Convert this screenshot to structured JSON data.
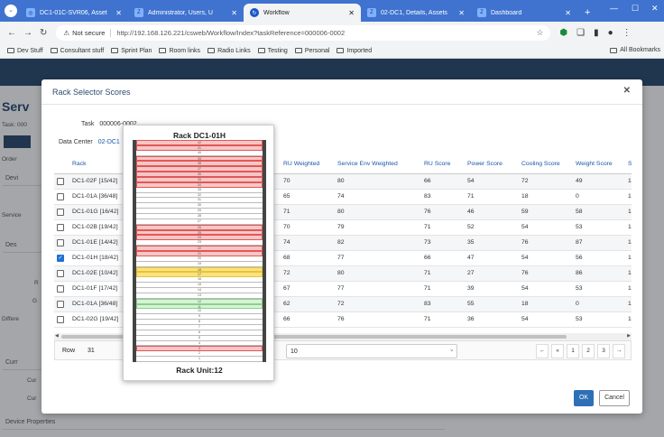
{
  "browser": {
    "tabs": [
      {
        "label": "DC1-01C-SVR06, Asset",
        "active": false
      },
      {
        "label": "Administrator, Users, U",
        "active": false
      },
      {
        "label": "Workflow",
        "active": true
      },
      {
        "label": "02-DC1, Details, Assets",
        "active": false
      },
      {
        "label": "Dashboard",
        "active": false
      }
    ],
    "security_label": "Not secure",
    "url": "http://192.168.126.221/csweb/Workflow/Index?taskReference=000006-0002",
    "bookmarks": [
      "Dev Stuff",
      "Consultant stuff",
      "Sprint Plan",
      "Room links",
      "Radio Links",
      "Testing",
      "Personal",
      "Imported"
    ],
    "all_bookmarks_label": "All Bookmarks"
  },
  "app": {
    "title": "Serv",
    "side_labels": [
      "Task: 000",
      "Order",
      "Service",
      "Differe",
      "R",
      "G",
      "Cur",
      "Cur"
    ],
    "section_labels": [
      "Devi",
      "Des",
      "Curr",
      "Device Properties"
    ]
  },
  "modal": {
    "title": "Rack Selector Scores",
    "task_label": "Task",
    "task_value": "000006-0002",
    "datacenter_label": "Data Center",
    "datacenter_value": "02-DC1",
    "columns": [
      "Rack",
      "RU Weighted",
      "Service Env Weighted",
      "RU Score",
      "Power Score",
      "Cooling Score",
      "Weight Score",
      "Sc"
    ],
    "rows": [
      {
        "checked": false,
        "rack": "DC1-02F [15/42]",
        "ru_w": "70",
        "env_w": "80",
        "ru_s": "66",
        "pow": "54",
        "cool": "72",
        "wt": "49",
        "sc": "1("
      },
      {
        "checked": false,
        "rack": "DC1-01A [36/48]",
        "ru_w": "65",
        "env_w": "74",
        "ru_s": "83",
        "pow": "71",
        "cool": "18",
        "wt": "0",
        "sc": "1("
      },
      {
        "checked": false,
        "rack": "DC1-01G [16/42]",
        "ru_w": "71",
        "env_w": "80",
        "ru_s": "76",
        "pow": "46",
        "cool": "59",
        "wt": "58",
        "sc": "1("
      },
      {
        "checked": false,
        "rack": "DC1-02B [19/42]",
        "ru_w": "70",
        "env_w": "79",
        "ru_s": "71",
        "pow": "52",
        "cool": "54",
        "wt": "53",
        "sc": "1("
      },
      {
        "checked": false,
        "rack": "DC1-01E [14/42]",
        "ru_w": "74",
        "env_w": "82",
        "ru_s": "73",
        "pow": "35",
        "cool": "76",
        "wt": "87",
        "sc": "1("
      },
      {
        "checked": true,
        "rack": "DC1-01H [18/42]",
        "ru_w": "68",
        "env_w": "77",
        "ru_s": "66",
        "pow": "47",
        "cool": "54",
        "wt": "56",
        "sc": "1("
      },
      {
        "checked": false,
        "rack": "DC1-02E [10/42]",
        "ru_w": "72",
        "env_w": "80",
        "ru_s": "71",
        "pow": "27",
        "cool": "76",
        "wt": "86",
        "sc": "1("
      },
      {
        "checked": false,
        "rack": "DC1-01F [17/42]",
        "ru_w": "67",
        "env_w": "77",
        "ru_s": "71",
        "pow": "39",
        "cool": "54",
        "wt": "53",
        "sc": "1("
      },
      {
        "checked": false,
        "rack": "DC1-01A [36/48]",
        "ru_w": "62",
        "env_w": "72",
        "ru_s": "83",
        "pow": "55",
        "cool": "18",
        "wt": "0",
        "sc": "1("
      },
      {
        "checked": false,
        "rack": "DC1-02G [19/42]",
        "ru_w": "66",
        "env_w": "76",
        "ru_s": "71",
        "pow": "36",
        "cool": "54",
        "wt": "53",
        "sc": "1("
      }
    ],
    "row_label": "Row",
    "row_value": "31",
    "page_size": "10",
    "pager": [
      "←",
      "«",
      "1",
      "2",
      "3",
      "→"
    ],
    "ok_label": "OK",
    "cancel_label": "Cancel"
  },
  "rack_popup": {
    "title": "Rack DC1-01H",
    "footer": "Rack Unit:12",
    "colors": {
      "used": "#f6c6c6",
      "selected": "#fbe27a",
      "fit": "#d6f3d6"
    },
    "units": [
      "42",
      "41",
      "40",
      "39",
      "38",
      "37",
      "36",
      "35",
      "34",
      "33",
      "32",
      "31",
      "30",
      "29",
      "28",
      "27",
      "26",
      "25",
      "24",
      "23",
      "22",
      "21",
      "20",
      "19",
      "18",
      "17",
      "16",
      "15",
      "14",
      "13",
      "12",
      "11",
      "10",
      "9",
      "8",
      "7",
      "6",
      "5",
      "4",
      "3",
      "2",
      "1"
    ],
    "unit_states": [
      "used",
      "used",
      "empty",
      "used",
      "used",
      "used",
      "used",
      "used",
      "used",
      "empty",
      "empty",
      "empty",
      "empty",
      "empty",
      "empty",
      "empty",
      "used",
      "used",
      "used",
      "empty",
      "used",
      "used",
      "empty",
      "empty",
      "sel",
      "sel",
      "empty",
      "empty",
      "empty",
      "empty",
      "fit",
      "fit",
      "empty",
      "empty",
      "empty",
      "empty",
      "empty",
      "empty",
      "empty",
      "used",
      "empty",
      "empty"
    ]
  }
}
